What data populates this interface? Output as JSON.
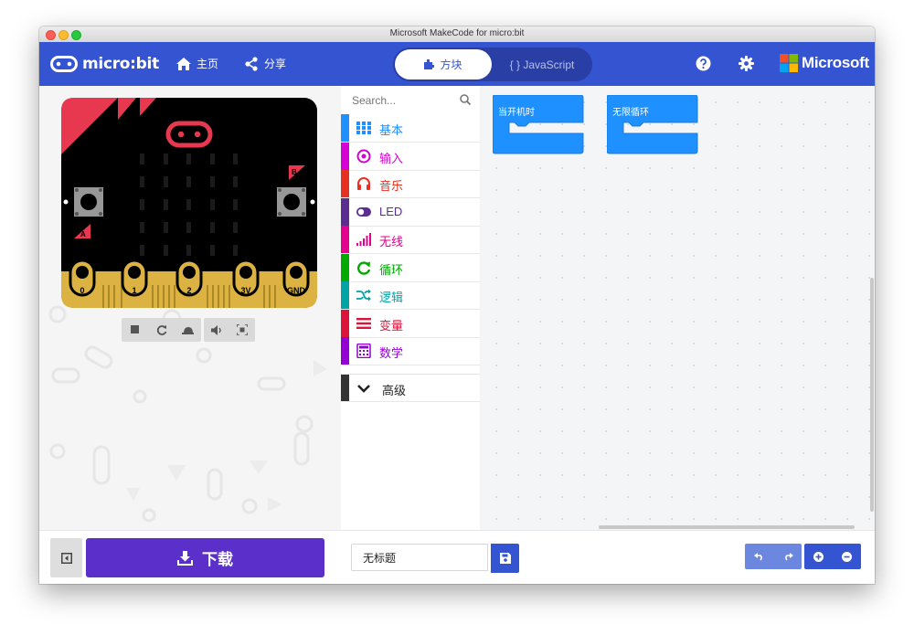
{
  "window": {
    "title": "Microsoft MakeCode for micro:bit"
  },
  "header": {
    "logo_text": "micro:bit",
    "nav": [
      {
        "label": "主页",
        "icon": "home-icon"
      },
      {
        "label": "分享",
        "icon": "share-icon"
      }
    ],
    "editor_toggle": {
      "blocks_label": "方块",
      "js_label": "{ } JavaScript",
      "active": "blocks"
    },
    "brand_text": "Microsoft",
    "colors": {
      "bar": "#3454d1",
      "toggle_bg": "#2a3fa6"
    }
  },
  "simulator": {
    "pin_labels": [
      "0",
      "1",
      "2",
      "3V",
      "GND"
    ],
    "button_a": "A",
    "button_b": "B",
    "toolbar": [
      "stop-icon",
      "restart-icon",
      "slow-mo-icon",
      "sound-icon",
      "screenshot-icon"
    ]
  },
  "toolbox": {
    "search_placeholder": "Search...",
    "categories": [
      {
        "label": "基本",
        "color": "#1e90ff",
        "icon": "grid-icon"
      },
      {
        "label": "输入",
        "color": "#d400d4",
        "icon": "target-icon"
      },
      {
        "label": "音乐",
        "color": "#e63022",
        "icon": "headphones-icon"
      },
      {
        "label": "LED",
        "color": "#5c2d91",
        "icon": "toggle-icon"
      },
      {
        "label": "无线",
        "color": "#e3008c",
        "icon": "signal-icon"
      },
      {
        "label": "循环",
        "color": "#00aa00",
        "icon": "loop-icon"
      },
      {
        "label": "逻辑",
        "color": "#00a4a6",
        "icon": "shuffle-icon"
      },
      {
        "label": "变量",
        "color": "#dc143c",
        "icon": "lines-icon"
      },
      {
        "label": "数学",
        "color": "#9400d3",
        "icon": "calculator-icon"
      }
    ],
    "advanced_label": "高级"
  },
  "workspace": {
    "blocks": [
      {
        "label": "当开机时"
      },
      {
        "label": "无限循环"
      }
    ],
    "block_color": "#1e90ff"
  },
  "footer": {
    "download_label": "下载",
    "project_name": "无标题",
    "download_color": "#5a2fca"
  }
}
